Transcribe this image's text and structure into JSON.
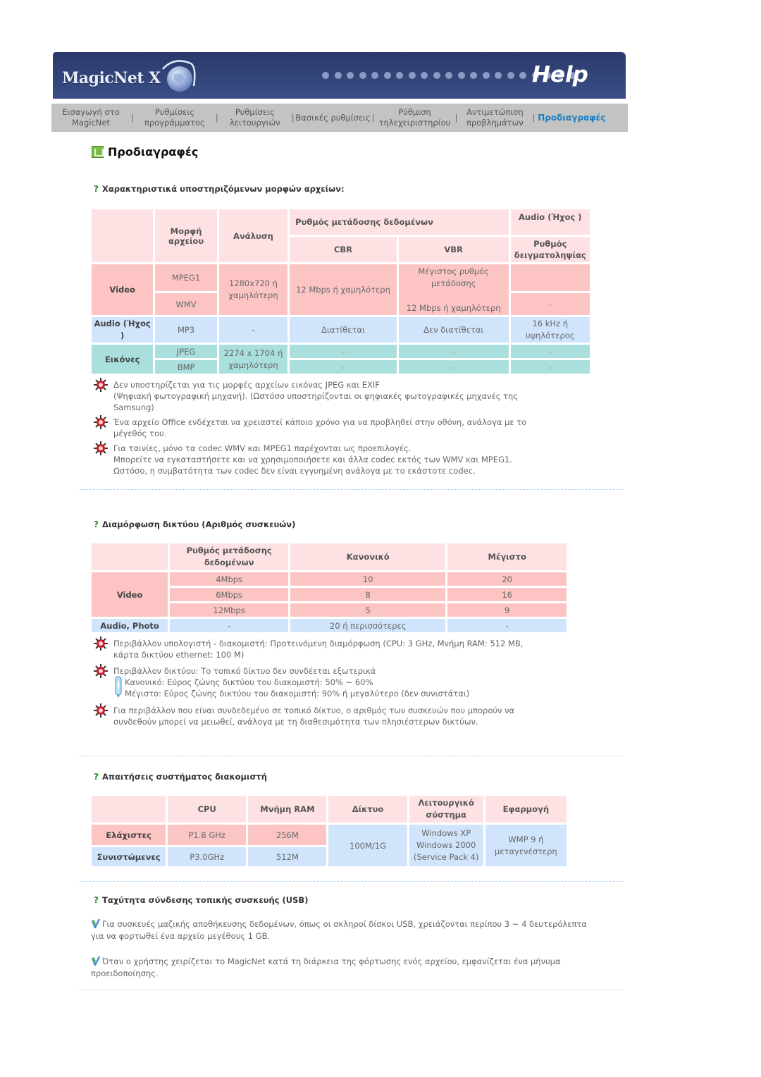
{
  "header": {
    "logo": "MagicNet X",
    "help": "Help",
    "banner_colors": {
      "dark": "#2b3a6c",
      "light": "#3b4f87"
    }
  },
  "nav": {
    "items": [
      {
        "line1": "Εισαγωγή στο",
        "line2": "MagicNet"
      },
      {
        "line1": "Ρυθμίσεις",
        "line2": "προγράμματος"
      },
      {
        "line1": "Ρυθμίσεις",
        "line2": "λειτουργιών"
      },
      {
        "line1": "Βασικές ρυθμίσεις",
        "line2": ""
      },
      {
        "line1": "Ρύθμιση",
        "line2": "τηλεχειριστηρίου"
      },
      {
        "line1": "Αντιμετώπιση",
        "line2": "προβλημάτων"
      },
      {
        "line1": "Προδιαγραφές",
        "line2": ""
      }
    ],
    "active_color": "#1b7fc4"
  },
  "page": {
    "title": "Προδιαγραφές"
  },
  "formats": {
    "heading": "Χαρακτηριστικά υποστηριζόμενων μορφών αρχείων:",
    "headers": {
      "format": "Μορφή αρχείου",
      "resolution": "Ανάλυση",
      "bitrate": "Ρυθμός μετάδοσης δεδομένων",
      "cbr": "CBR",
      "vbr": "VBR",
      "audio": "Audio (Ήχος )",
      "sampling": "Ρυθμός δειγματοληψίας"
    },
    "video": {
      "label": "Video",
      "mpeg1": "MPEG1",
      "wmv": "WMV",
      "resolution": "1280x720 ή χαμηλότερη",
      "cbr": "12 Mbps ή χαμηλότερη",
      "vbr_line1": "Μέγιστος ρυθμός μετάδοσης",
      "vbr_line2": "12 Mbps ή χαμηλότερη",
      "sampling_wmv": "-"
    },
    "audio": {
      "label": "Audio (Ήχος )",
      "format": "MP3",
      "resolution": "-",
      "cbr": "Διατίθεται",
      "vbr": "Δεν διατίθεται",
      "sampling": "16 kHz ή υψηλότερος"
    },
    "images": {
      "label": "Εικόνες",
      "jpeg": "JPEG",
      "bmp": "BMP",
      "resolution": "2274 x 1704 ή χαμηλότερη",
      "dash": "-"
    },
    "notes": [
      [
        "Δεν υποστηρίζεται για τις μορφές αρχείων εικόνας JPEG και EXIF",
        "(Ψηφιακή φωτογραφική μηχανή). (Ωστόσο υποστηρίζονται οι ψηφιακές φωτογραφικές μηχανές της",
        "Samsung)"
      ],
      [
        "Ένα αρχείο Office ενδέχεται να χρειαστεί κάποιο χρόνο για να προβληθεί στην οθόνη, ανάλογα με το",
        "μέγεθός του."
      ],
      [
        "Για ταινίες, μόνο τα codec WMV και MPEG1 παρέχονται ως προεπιλογές.",
        "Μπορείτε να εγκαταστήσετε και να χρησιμοποιήσετε και άλλα codec εκτός των WMV και MPEG1.",
        "Ωστόσο, η συμβατότητα των codec δεν είναι εγγυημένη ανάλογα με το εκάστοτε codec."
      ]
    ]
  },
  "network": {
    "heading": "Διαμόρφωση δικτύου (Αριθμός συσκευών)",
    "headers": {
      "rate": "Ρυθμός μετάδοσης δεδομένων",
      "normal": "Κανονικό",
      "max": "Μέγιστο"
    },
    "video_label": "Video",
    "video_rows": [
      {
        "rate": "4Mbps",
        "normal": "10",
        "max": "20"
      },
      {
        "rate": "6Mbps",
        "normal": "8",
        "max": "16"
      },
      {
        "rate": "12Mbps",
        "normal": "5",
        "max": "9"
      }
    ],
    "audio_row": {
      "label": "Audio, Photo",
      "rate": "-",
      "normal": "20 ή περισσότερες",
      "max": "-"
    },
    "notes": {
      "env_pc": [
        "Περιβάλλον υπολογιστή - διακομιστή: Προτεινόμενη διαμόρφωση (CPU: 3 GHz, Μνήμη RAM: 512 MB,",
        "κάρτα δικτύου ethernet: 100 M)"
      ],
      "env_net": "Περιβάλλον δικτύου: Το τοπικό δίκτυο δεν συνδέεται εξωτερικά",
      "normal_bw": "Κανονικό: Εύρος ζώνης δικτύου του διακομιστή: 50% ~ 60%",
      "max_bw": "Μέγιστο: Εύρος ζώνης δικτύου του διακομιστή: 90% ή μεγαλύτερο (δεν συνιστάται)",
      "local": [
        "Για περιβάλλον που είναι συνδεδεμένο σε τοπικό δίκτυο, ο αριθμός των συσκευών που μπορούν να",
        "συνδεθούν μπορεί να μειωθεί, ανάλογα με τη διαθεσιμότητα των πλησιέστερων δικτύων."
      ]
    }
  },
  "server": {
    "heading": "Απαιτήσεις συστήματος διακομιστή",
    "headers": {
      "cpu": "CPU",
      "ram": "Μνήμη RAM",
      "network": "Δίκτυο",
      "os": "Λειτουργικό σύστημα",
      "app": "Εφαρμογή"
    },
    "min": {
      "label": "Ελάχιστες",
      "cpu": "P1.8 GHz",
      "ram": "256M"
    },
    "rec": {
      "label": "Συνιστώμενες",
      "cpu": "P3.0GHz",
      "ram": "512M"
    },
    "network": "100M/1G",
    "os": [
      "Windows XP",
      "Windows 2000",
      "(Service Pack 4)"
    ],
    "app": "WMP 9 ή μεταγενέστερη"
  },
  "usb": {
    "heading": "Ταχύτητα σύνδεσης τοπικής συσκευής (USB)",
    "notes": [
      "Για συσκευές μαζικής αποθήκευσης δεδομένων, όπως οι σκληροί δίσκοι USB, χρειάζονται περίπου 3 ~ 4 δευτερόλεπτα για να φορτωθεί ένα αρχείο μεγέθους 1 GB.",
      "Όταν ο χρήστης χειρίζεται το MagicNet κατά τη διάρκεια της φόρτωσης ενός αρχείου, εμφανίζεται ένα μήνυμα προειδοποίησης."
    ]
  }
}
